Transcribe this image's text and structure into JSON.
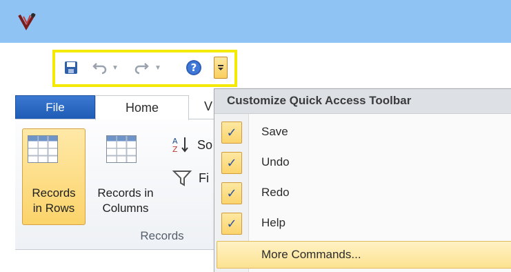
{
  "window": {
    "logo_icon": "access-logo-icon"
  },
  "quick_access_toolbar": {
    "highlight_color": "#f4e900",
    "buttons": [
      {
        "icon": "save-icon"
      },
      {
        "icon": "undo-icon"
      },
      {
        "icon": "redo-icon"
      },
      {
        "icon": "help-icon"
      },
      {
        "icon": "customize-dropdown-icon"
      }
    ]
  },
  "ribbon": {
    "tabs": {
      "file": "File",
      "home": "Home",
      "view_partial": "V"
    },
    "records_group": {
      "rows_label_line1": "Records",
      "rows_label_line2": "in Rows",
      "columns_label_line1": "Records in",
      "columns_label_line2": "Columns",
      "group_label": "Records",
      "sort_label_partial": "So",
      "filter_label_partial": "Fi"
    }
  },
  "menu": {
    "title": "Customize Quick Access Toolbar",
    "check_glyph": "✓",
    "items": [
      {
        "label": "Save",
        "checked": true
      },
      {
        "label": "Undo",
        "checked": true
      },
      {
        "label": "Redo",
        "checked": true
      },
      {
        "label": "Help",
        "checked": true
      }
    ],
    "more": "More Commands..."
  }
}
